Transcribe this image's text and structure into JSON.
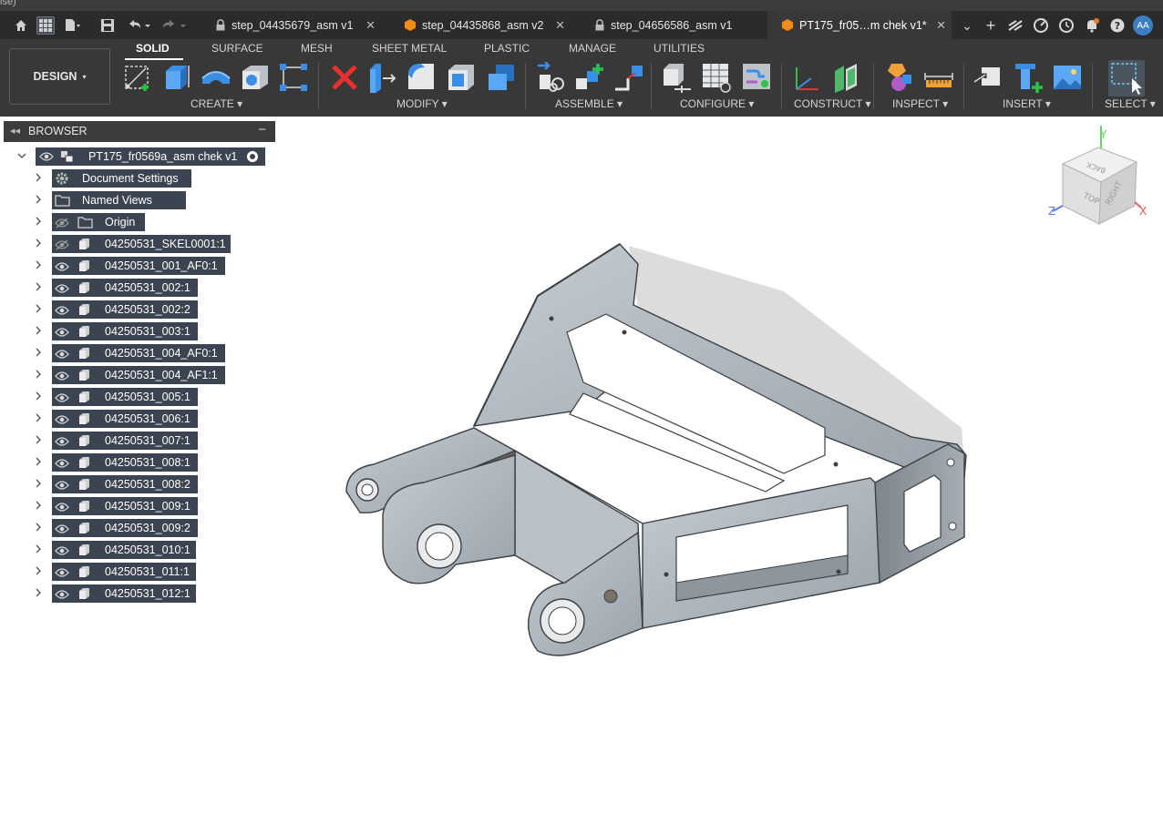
{
  "title_fragment": "ise)",
  "doc_tabs": [
    {
      "label": "step_04435679_asm v1",
      "type": "locked",
      "active": false
    },
    {
      "label": "step_04435868_asm v2",
      "type": "part",
      "active": false
    },
    {
      "label": "step_04656586_asm v1",
      "type": "locked",
      "active": false
    },
    {
      "label": "PT175_fr05…m chek v1*",
      "type": "part",
      "active": true
    }
  ],
  "user_initials": "AA",
  "toolbar": {
    "design_label": "DESIGN",
    "workspace_tabs": [
      "SOLID",
      "SURFACE",
      "MESH",
      "SHEET METAL",
      "PLASTIC",
      "MANAGE",
      "UTILITIES"
    ],
    "groups": [
      "CREATE",
      "MODIFY",
      "ASSEMBLE",
      "CONFIGURE",
      "CONSTRUCT",
      "INSPECT",
      "INSERT",
      "SELECT"
    ]
  },
  "browser": {
    "title": "BROWSER",
    "root": "PT175_fr0569a_asm chek v1",
    "items": [
      {
        "label": "Document Settings",
        "icon": "gear-icon"
      },
      {
        "label": "Named Views",
        "icon": "folder-icon"
      },
      {
        "label": "Origin",
        "icon": "folder-icon",
        "hidden": true
      },
      {
        "label": "04250531_SKEL0001:1",
        "icon": "component-icon",
        "hidden": true
      },
      {
        "label": "04250531_001_AF0:1",
        "icon": "component-icon"
      },
      {
        "label": "04250531_002:1",
        "icon": "component-icon"
      },
      {
        "label": "04250531_002:2",
        "icon": "component-icon"
      },
      {
        "label": "04250531_003:1",
        "icon": "component-icon"
      },
      {
        "label": "04250531_004_AF0:1",
        "icon": "component-icon"
      },
      {
        "label": "04250531_004_AF1:1",
        "icon": "component-icon"
      },
      {
        "label": "04250531_005:1",
        "icon": "component-icon"
      },
      {
        "label": "04250531_006:1",
        "icon": "component-icon"
      },
      {
        "label": "04250531_007:1",
        "icon": "component-icon"
      },
      {
        "label": "04250531_008:1",
        "icon": "component-icon"
      },
      {
        "label": "04250531_008:2",
        "icon": "component-icon"
      },
      {
        "label": "04250531_009:1",
        "icon": "component-icon"
      },
      {
        "label": "04250531_009:2",
        "icon": "component-icon"
      },
      {
        "label": "04250531_010:1",
        "icon": "component-icon"
      },
      {
        "label": "04250531_011:1",
        "icon": "component-icon"
      },
      {
        "label": "04250531_012:1",
        "icon": "component-icon"
      }
    ]
  },
  "viewcube": {
    "faces": [
      "TOP",
      "RIGHT",
      "BACK"
    ],
    "axes": [
      "X",
      "Y",
      "Z"
    ]
  }
}
